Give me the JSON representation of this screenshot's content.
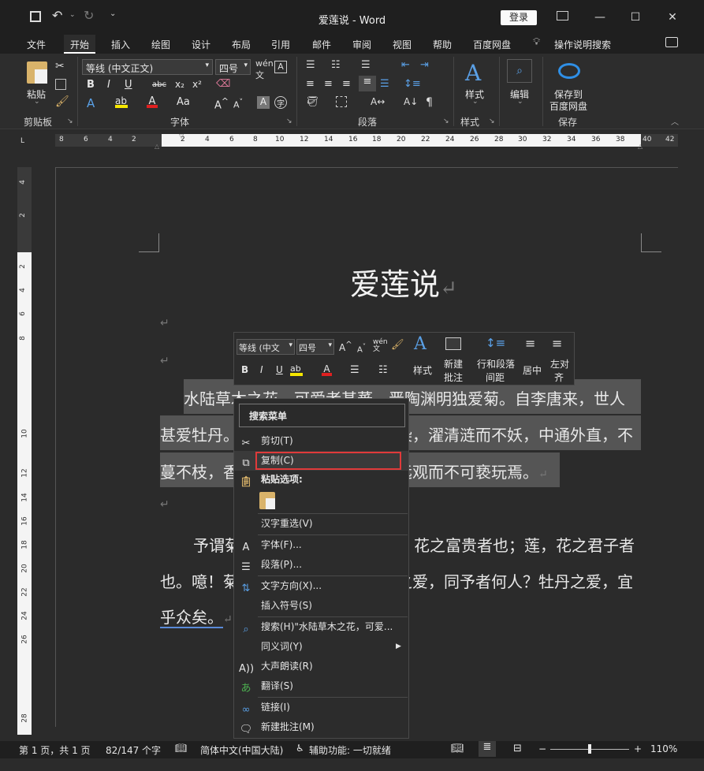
{
  "window": {
    "title": "爱莲说  -  Word",
    "login": "登录",
    "minimize": "—",
    "maximize": "☐",
    "close": "✕"
  },
  "menu": [
    "文件",
    "开始",
    "插入",
    "绘图",
    "设计",
    "布局",
    "引用",
    "邮件",
    "审阅",
    "视图",
    "帮助",
    "百度网盘"
  ],
  "menu_active": "开始",
  "tell_me": "操作说明搜索",
  "ribbon": {
    "paste": "粘贴",
    "clipboard": "剪贴板",
    "font_name": "等线 (中文正文)",
    "font_size": "四号",
    "font_group": "字体",
    "paragraph_group": "段落",
    "styles": "样式",
    "styles_group": "样式",
    "edit": "编辑",
    "save_to": "保存到",
    "baidu": "百度网盘",
    "save_group": "保存"
  },
  "ruler": {
    "left": [
      "8",
      "6",
      "4",
      "2"
    ],
    "middle": [
      "2",
      "4",
      "6",
      "8",
      "10",
      "12",
      "14",
      "16",
      "18",
      "20",
      "22",
      "24",
      "26",
      "28",
      "30",
      "32",
      "34",
      "36",
      "38"
    ],
    "right": [
      "40",
      "42"
    ],
    "vertical": [
      "4",
      "2",
      "2",
      "4",
      "6",
      "8",
      "10",
      "12",
      "14",
      "16",
      "18",
      "20",
      "22",
      "24",
      "26",
      "28"
    ]
  },
  "doc": {
    "title": "爱莲说",
    "p1a": "水陆草木之花，可爱者甚蕃。晋陶渊明独爱菊。自李唐来，世人",
    "p1b": "甚爱牡丹。予独爱莲之出淤泥而不染，濯清涟而不妖，中通外直，不",
    "p1c": "蔓不枝，香远益清，亭亭净植，可远观而不可亵玩焉。",
    "p2a": "予谓菊，花之隐逸者也；牡丹，花之富贵者也；莲，花之君子者",
    "p2b": "也。噫！菊之爱，陶后鲜有闻。莲之爱，同予者何人？牡丹之爱，宜",
    "p2c": "乎众矣。"
  },
  "mini_toolbar": {
    "font": "等线 (中文",
    "size": "四号",
    "styles": "样式",
    "new_comment_1": "新建",
    "new_comment_2": "批注",
    "spacing_1": "行和段落",
    "spacing_2": "间距",
    "center": "居中",
    "left_1": "左对",
    "left_2": "齐"
  },
  "context_menu": {
    "search": "搜索菜单",
    "cut": "剪切(T)",
    "copy": "复制(C)",
    "paste_options": "粘贴选项:",
    "reconvert": "汉字重选(V)",
    "font": "字体(F)...",
    "paragraph": "段落(P)...",
    "text_direction": "文字方向(X)...",
    "insert_symbol": "插入符号(S)",
    "smart_lookup": "搜索(H)\"水陆草木之花，可爱...",
    "synonyms": "同义词(Y)",
    "read_aloud": "大声朗读(R)",
    "translate": "翻译(S)",
    "link": "链接(I)",
    "new_comment": "新建批注(M)"
  },
  "status": {
    "page": "第 1 页，共 1 页",
    "words": "82/147 个字",
    "lang": "简体中文(中国大陆)",
    "accessibility": "辅助功能: 一切就绪",
    "zoom": "110%"
  }
}
